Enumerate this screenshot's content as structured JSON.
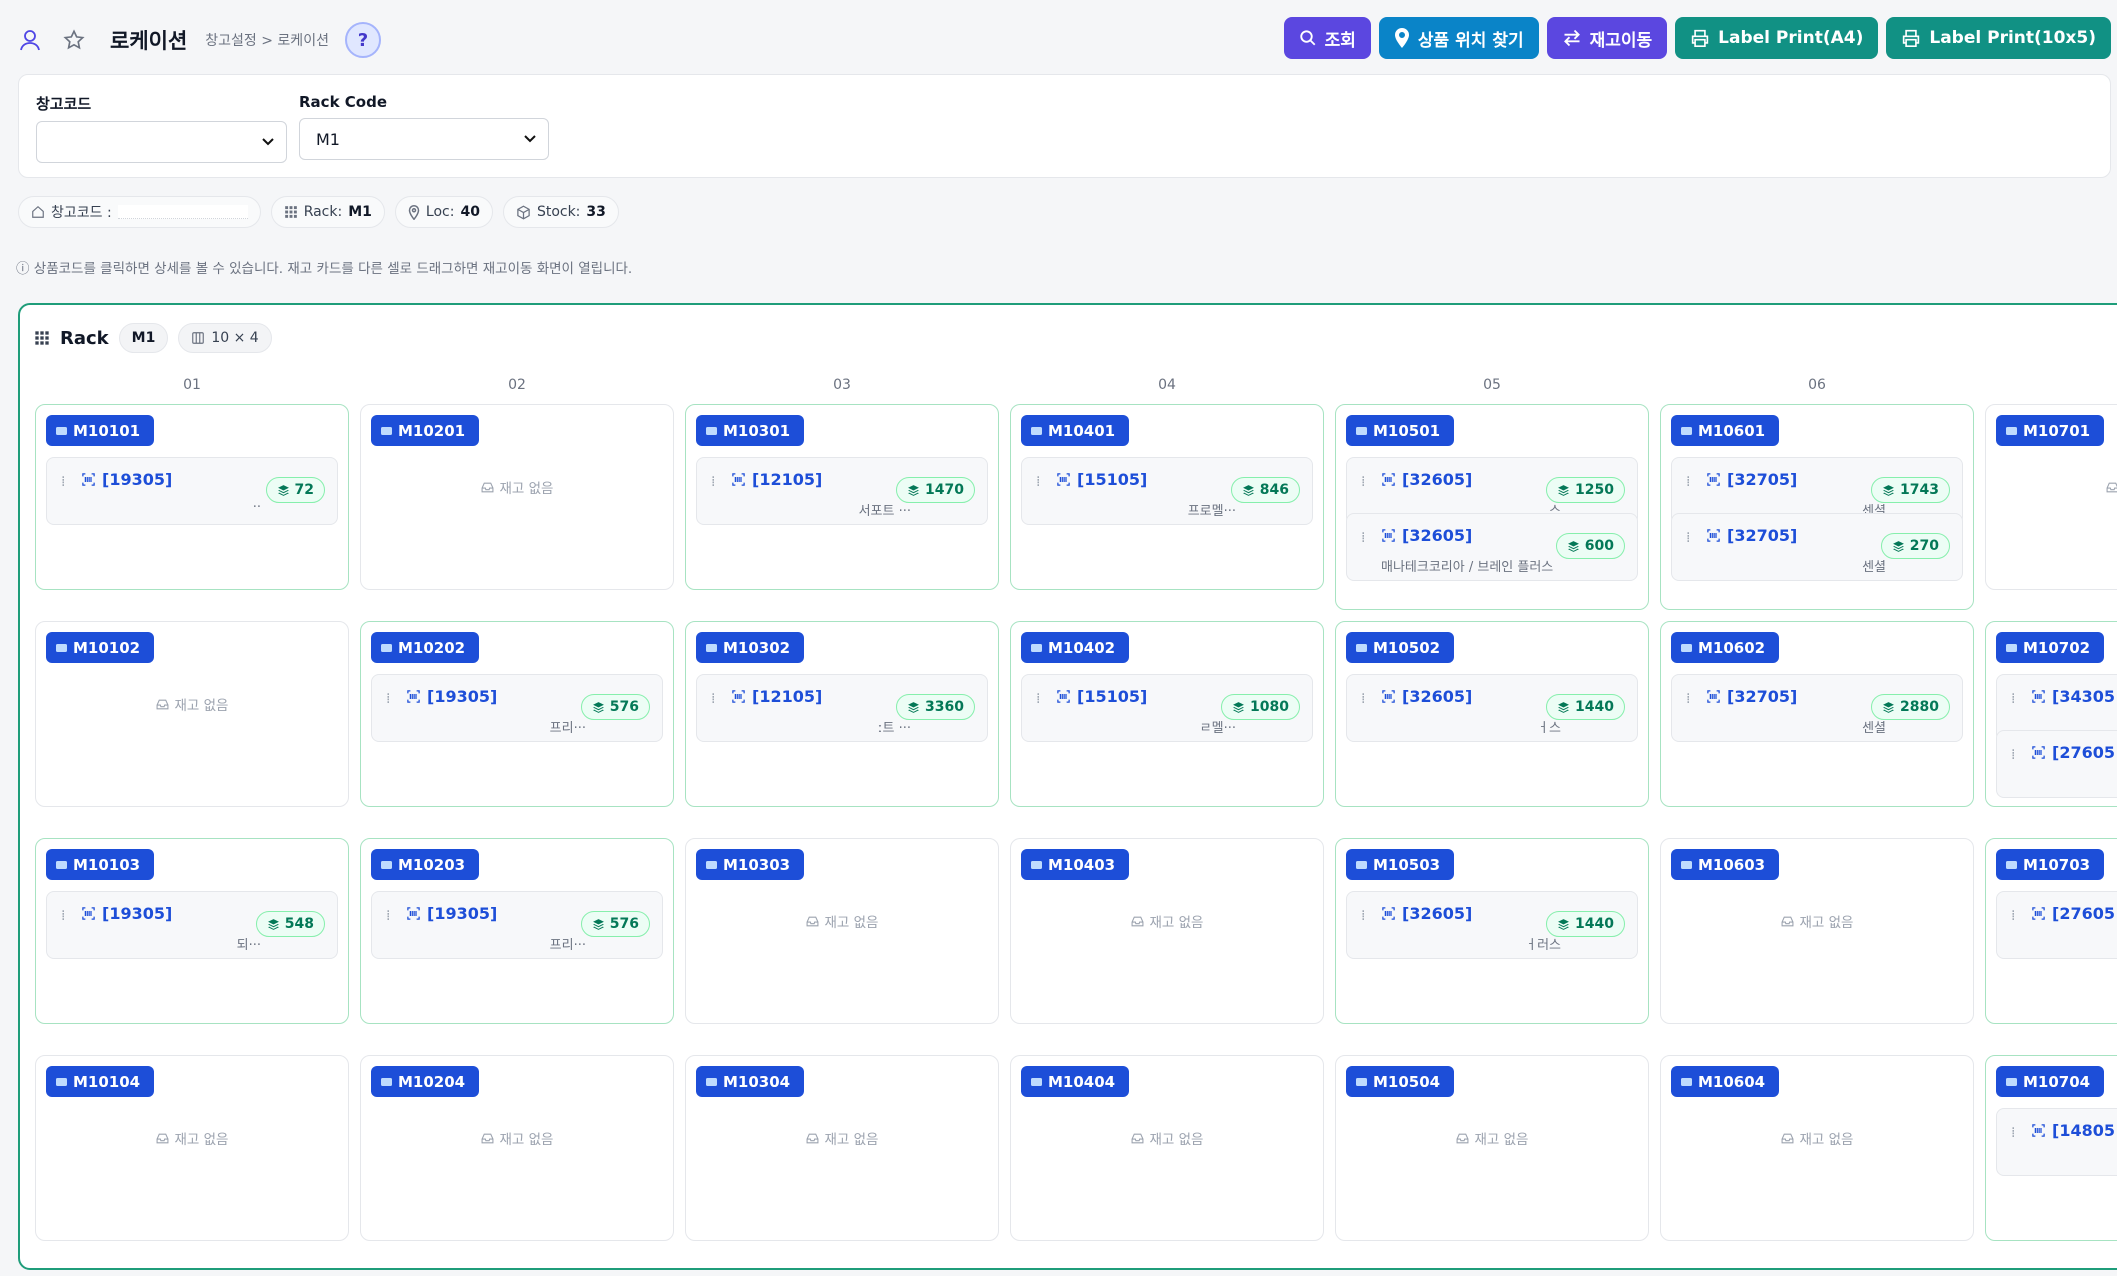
{
  "header": {
    "title": "로케이션",
    "breadcrumb": "창고설정 > 로케이션",
    "help": "?"
  },
  "actions": {
    "search": "조회",
    "find_location": "상품 위치 찾기",
    "move_stock": "재고이동",
    "label_a4": "Label Print(A4)",
    "label_10x5": "Label Print(10x5)"
  },
  "filters": {
    "warehouse_label": "창고코드",
    "warehouse_value": "",
    "rack_label": "Rack Code",
    "rack_value": "M1"
  },
  "summary": {
    "warehouse_label": "창고코드 :",
    "rack_label": "Rack:",
    "rack_value": "M1",
    "loc_label": "Loc:",
    "loc_value": "40",
    "stock_label": "Stock:",
    "stock_value": "33"
  },
  "hint": "ⓘ 상품코드를 클릭하면 상세를 볼 수 있습니다. 재고 카드를 다른 셀로 드래그하면 재고이동 화면이 열립니다.",
  "rack": {
    "title": "Rack",
    "code": "M1",
    "size": "10 × 4",
    "empty_text": "재고 없음",
    "columns": [
      "01",
      "02",
      "03",
      "04",
      "05",
      "06"
    ],
    "cells": [
      {
        "loc": "M10101",
        "items": [
          {
            "code": "[19305]",
            "qty": "72",
            "name": "··"
          }
        ]
      },
      {
        "loc": "M10201",
        "items": []
      },
      {
        "loc": "M10301",
        "items": [
          {
            "code": "[12105]",
            "qty": "1470",
            "name": "서포트 ···"
          }
        ]
      },
      {
        "loc": "M10401",
        "items": [
          {
            "code": "[15105]",
            "qty": "846",
            "name": "프로멜···"
          }
        ]
      },
      {
        "loc": "M10501",
        "items": [
          {
            "code": "[32605]",
            "qty": "1250",
            "name": "스"
          },
          {
            "code": "[32605]",
            "qty": "600",
            "name": "매나테크코리아 / 브레인 플러스"
          }
        ]
      },
      {
        "loc": "M10601",
        "items": [
          {
            "code": "[32705]",
            "qty": "1743",
            "name": "센셜"
          },
          {
            "code": "[32705]",
            "qty": "270",
            "name": "센셜"
          }
        ]
      },
      {
        "loc": "M10701",
        "items": []
      },
      {
        "loc": "M10102",
        "items": []
      },
      {
        "loc": "M10202",
        "items": [
          {
            "code": "[19305]",
            "qty": "576",
            "name": "프리···"
          }
        ]
      },
      {
        "loc": "M10302",
        "items": [
          {
            "code": "[12105]",
            "qty": "3360",
            "name": "ː트 ···"
          }
        ]
      },
      {
        "loc": "M10402",
        "items": [
          {
            "code": "[15105]",
            "qty": "1080",
            "name": "ㄹ멜···"
          }
        ]
      },
      {
        "loc": "M10502",
        "items": [
          {
            "code": "[32605]",
            "qty": "1440",
            "name": "ㅓ스"
          }
        ]
      },
      {
        "loc": "M10602",
        "items": [
          {
            "code": "[32705]",
            "qty": "2880",
            "name": "센셜"
          }
        ]
      },
      {
        "loc": "M10702",
        "items": [
          {
            "code": "[34305",
            "qty": "",
            "name": ""
          },
          {
            "code": "[27605",
            "qty": "",
            "name": ""
          }
        ]
      },
      {
        "loc": "M10103",
        "items": [
          {
            "code": "[19305]",
            "qty": "548",
            "name": "되···"
          }
        ]
      },
      {
        "loc": "M10203",
        "items": [
          {
            "code": "[19305]",
            "qty": "576",
            "name": "프리···"
          }
        ]
      },
      {
        "loc": "M10303",
        "items": []
      },
      {
        "loc": "M10403",
        "items": []
      },
      {
        "loc": "M10503",
        "items": [
          {
            "code": "[32605]",
            "qty": "1440",
            "name": "ㅓ러스"
          }
        ]
      },
      {
        "loc": "M10603",
        "items": []
      },
      {
        "loc": "M10703",
        "items": [
          {
            "code": "[27605",
            "qty": "",
            "name": ""
          }
        ]
      },
      {
        "loc": "M10104",
        "items": []
      },
      {
        "loc": "M10204",
        "items": []
      },
      {
        "loc": "M10304",
        "items": []
      },
      {
        "loc": "M10404",
        "items": []
      },
      {
        "loc": "M10504",
        "items": []
      },
      {
        "loc": "M10604",
        "items": []
      },
      {
        "loc": "M10704",
        "items": [
          {
            "code": "[14805",
            "qty": "",
            "name": ""
          }
        ]
      }
    ]
  }
}
